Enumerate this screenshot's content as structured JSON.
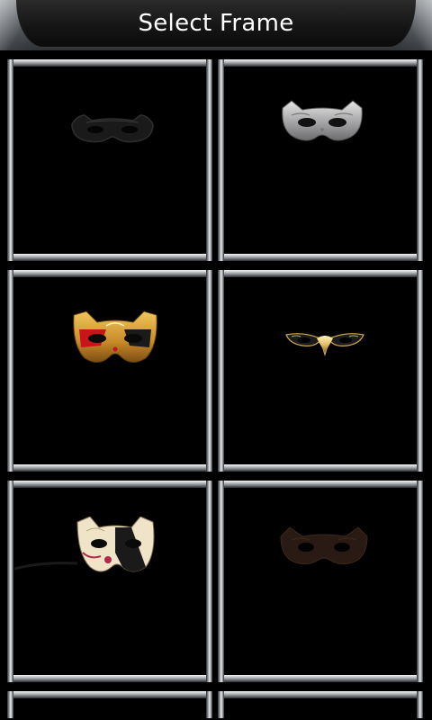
{
  "header": {
    "title": "Select Frame"
  },
  "frames": [
    {
      "name": "frame-1",
      "mask": "black-cat-mask-icon"
    },
    {
      "name": "frame-2",
      "mask": "silver-cat-mask-icon"
    },
    {
      "name": "frame-3",
      "mask": "red-gold-harlequin-mask-icon"
    },
    {
      "name": "frame-4",
      "mask": "gold-slim-mask-icon"
    },
    {
      "name": "frame-5",
      "mask": "cream-harlequin-cat-mask-icon"
    },
    {
      "name": "frame-6",
      "mask": "brown-cat-mask-icon"
    }
  ],
  "colors": {
    "background": "#000000",
    "title_text": "#ffffff",
    "chrome": "#b9bcbf"
  }
}
